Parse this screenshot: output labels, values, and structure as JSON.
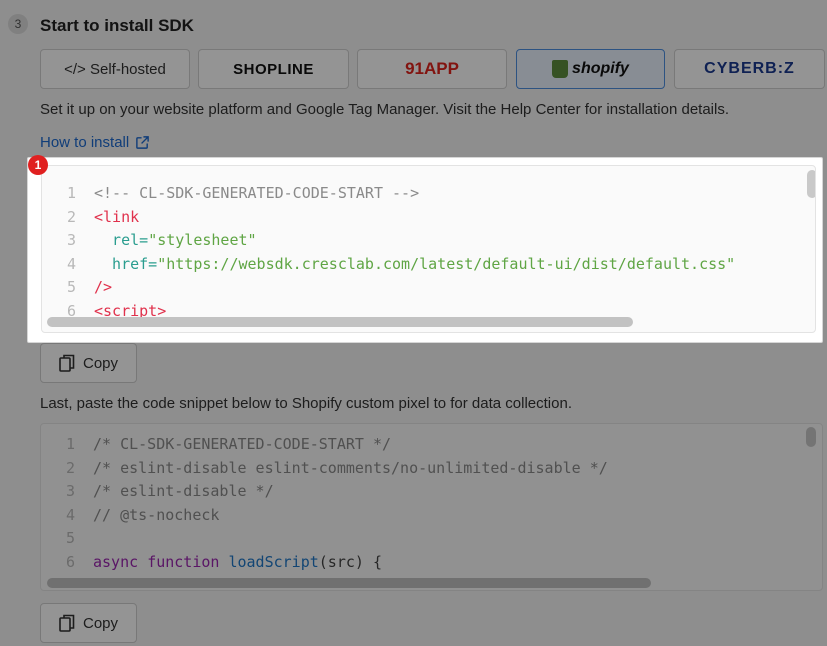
{
  "step": {
    "number": "3",
    "title": "Start to install SDK"
  },
  "platforms": [
    {
      "label": "Self-hosted",
      "icon": "code-icon",
      "selected": false
    },
    {
      "label": "SHOPLINE",
      "selected": false
    },
    {
      "label": "91APP",
      "selected": false
    },
    {
      "label": "shopify",
      "icon": "shopify-bag-icon",
      "selected": true
    },
    {
      "label": "CYBERB:Z",
      "selected": false
    }
  ],
  "description": "Set it up on your website platform and Google Tag Manager. Visit the Help Center for installation details.",
  "how_to_install": "How to install",
  "highlight_marker": "1",
  "code1": {
    "lines": [
      {
        "n": "1",
        "parts": [
          {
            "t": "<!-- CL-SDK-GENERATED-CODE-START -->",
            "c": "c-comment"
          }
        ]
      },
      {
        "n": "2",
        "parts": [
          {
            "t": "<link",
            "c": "c-tag"
          }
        ]
      },
      {
        "n": "3",
        "parts": [
          {
            "t": "  rel=",
            "c": "c-attr"
          },
          {
            "t": "\"stylesheet\"",
            "c": "c-str"
          }
        ]
      },
      {
        "n": "4",
        "parts": [
          {
            "t": "  href=",
            "c": "c-attr"
          },
          {
            "t": "\"https://websdk.cresclab.com/latest/default-ui/dist/default.css\"",
            "c": "c-str"
          }
        ]
      },
      {
        "n": "5",
        "parts": [
          {
            "t": "/>",
            "c": "c-tag"
          }
        ]
      },
      {
        "n": "6",
        "parts": [
          {
            "t": "<script>",
            "c": "c-tag"
          }
        ]
      }
    ]
  },
  "copy_label": "Copy",
  "last_text": "Last, paste the code snippet below to Shopify custom pixel to for data collection.",
  "code2": {
    "lines": [
      {
        "n": "1",
        "parts": [
          {
            "t": "/* CL-SDK-GENERATED-CODE-START */",
            "c": "c-comment"
          }
        ]
      },
      {
        "n": "2",
        "parts": [
          {
            "t": "/* eslint-disable eslint-comments/no-unlimited-disable */",
            "c": "c-comment"
          }
        ]
      },
      {
        "n": "3",
        "parts": [
          {
            "t": "/* eslint-disable */",
            "c": "c-comment"
          }
        ]
      },
      {
        "n": "4",
        "parts": [
          {
            "t": "// @ts-nocheck",
            "c": "c-comment"
          }
        ]
      },
      {
        "n": "5",
        "parts": []
      },
      {
        "n": "6",
        "parts": [
          {
            "t": "async ",
            "c": "c-kw"
          },
          {
            "t": "function ",
            "c": "c-kw"
          },
          {
            "t": "loadScript",
            "c": "c-fn"
          },
          {
            "t": "(src) {",
            "c": "c-plain"
          }
        ]
      }
    ]
  }
}
